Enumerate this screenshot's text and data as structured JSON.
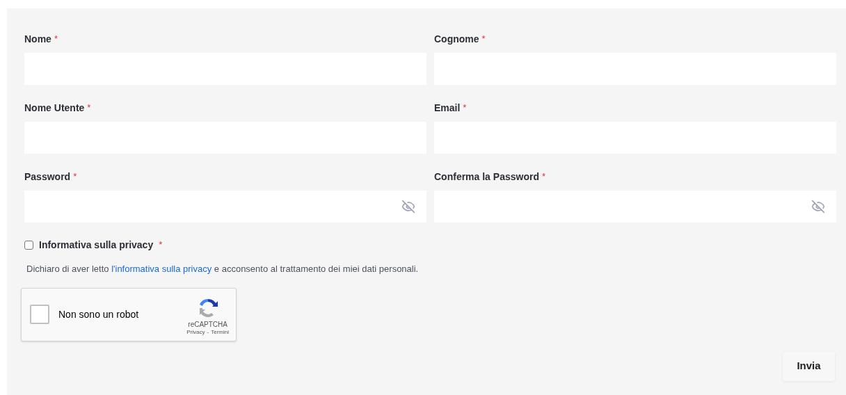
{
  "fields": [
    {
      "label": "Nome",
      "required_mark": "*",
      "kind": "text"
    },
    {
      "label": "Cognome",
      "required_mark": "*",
      "kind": "text"
    },
    {
      "label": "Nome Utente",
      "required_mark": "*",
      "kind": "text"
    },
    {
      "label": "Email",
      "required_mark": "*",
      "kind": "text"
    },
    {
      "label": "Password",
      "required_mark": "*",
      "kind": "password"
    },
    {
      "label": "Conferma la Password",
      "required_mark": "*",
      "kind": "password"
    }
  ],
  "privacy": {
    "label": "Informativa sulla privacy",
    "required_mark": "*",
    "checked": false
  },
  "consent": {
    "before": "Dichiaro di aver letto ",
    "link": "l'informativa sulla privacy",
    "after": " e acconsento al trattamento dei miei dati personali."
  },
  "captcha": {
    "label": "Non sono un robot",
    "checked": false,
    "brand": "reCAPTCHA",
    "privacy_link": "Privacy",
    "separator": "-",
    "terms_link": "Termini"
  },
  "submit": "Invia"
}
